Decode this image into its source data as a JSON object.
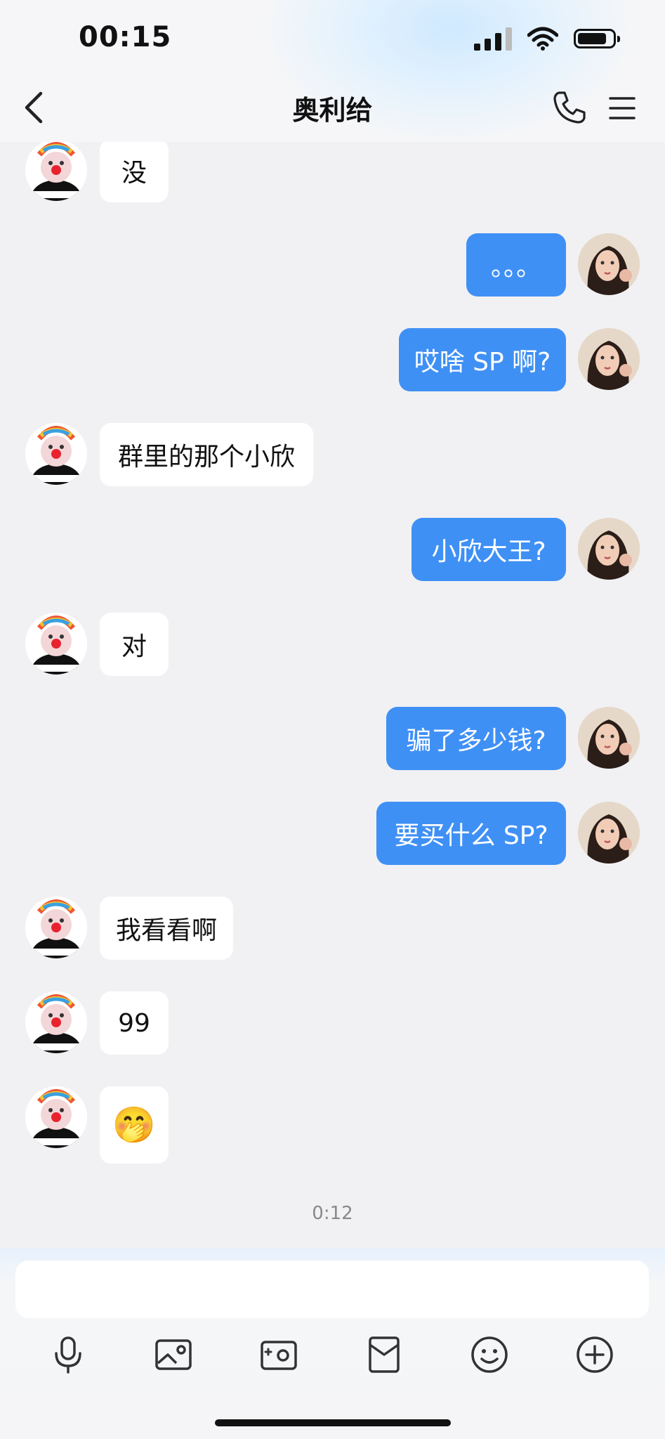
{
  "status_bar": {
    "time": "00:15"
  },
  "header": {
    "title": "奥利给"
  },
  "messages": [
    {
      "side": "in",
      "text": "没"
    },
    {
      "side": "out",
      "text": "。。。"
    },
    {
      "side": "out",
      "text": "哎啥 SP 啊?"
    },
    {
      "side": "in",
      "text": "群里的那个小欣"
    },
    {
      "side": "out",
      "text": "小欣大王?"
    },
    {
      "side": "in",
      "text": "对"
    },
    {
      "side": "out",
      "text": "骗了多少钱?"
    },
    {
      "side": "out",
      "text": "要买什么 SP?"
    },
    {
      "side": "in",
      "text": "我看看啊"
    },
    {
      "side": "in",
      "text": "99"
    },
    {
      "side": "in",
      "text": "🤭"
    }
  ],
  "timestamp": "0:12",
  "composer": {
    "input_placeholder": "",
    "tools": [
      "microphone-icon",
      "gallery-icon",
      "camera-icon",
      "red-packet-icon",
      "emoji-icon",
      "plus-icon"
    ]
  },
  "colors": {
    "outgoing_bubble": "#3f90f5",
    "incoming_bubble": "#ffffff",
    "background": "#f1f1f3"
  }
}
